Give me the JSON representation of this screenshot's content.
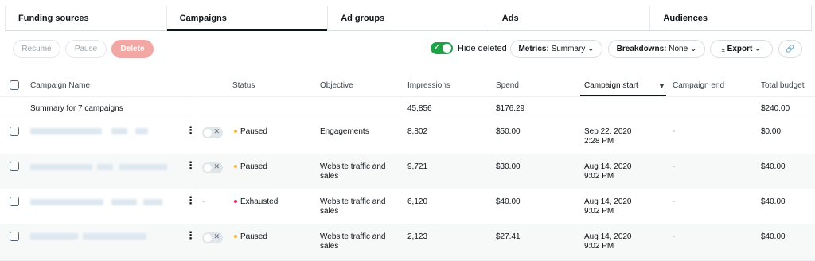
{
  "tabs": [
    "Funding sources",
    "Campaigns",
    "Ad groups",
    "Ads",
    "Audiences"
  ],
  "toolbar": {
    "resume": "Resume",
    "pause": "Pause",
    "delete": "Delete",
    "hide_deleted": "Hide deleted",
    "metrics_label": "Metrics:",
    "metrics_value": "Summary",
    "breakdowns_label": "Breakdowns:",
    "breakdowns_value": "None",
    "export": "Export"
  },
  "columns": {
    "name": "Campaign Name",
    "status": "Status",
    "objective": "Objective",
    "impressions": "Impressions",
    "spend": "Spend",
    "start": "Campaign start",
    "end": "Campaign end",
    "budget": "Total budget"
  },
  "summary": {
    "label": "Summary for 7 campaigns",
    "impressions": "45,856",
    "spend": "$176.29",
    "budget": "$240.00"
  },
  "rows": [
    {
      "status": "Paused",
      "status_color": "#f5b73b",
      "objective": "Engagements",
      "objective2": "",
      "impressions": "8,802",
      "spend": "$50.00",
      "start": "Sep 22, 2020",
      "start_time": "2:28 PM",
      "end": "-",
      "budget": "$0.00",
      "toggle": "-"
    },
    {
      "status": "Paused",
      "status_color": "#f5b73b",
      "objective": "Website traffic and",
      "objective2": "sales",
      "impressions": "9,721",
      "spend": "$30.00",
      "start": "Aug 14, 2020",
      "start_time": "9:02 PM",
      "end": "-",
      "budget": "$40.00",
      "toggle": "-"
    },
    {
      "status": "Exhausted",
      "status_color": "#e0245e",
      "objective": "Website traffic and",
      "objective2": "sales",
      "impressions": "6,120",
      "spend": "$40.00",
      "start": "Aug 14, 2020",
      "start_time": "9:02 PM",
      "end": "-",
      "budget": "$40.00",
      "toggle": "-"
    },
    {
      "status": "Paused",
      "status_color": "#f5b73b",
      "objective": "Website traffic and",
      "objective2": "sales",
      "impressions": "2,123",
      "spend": "$27.41",
      "start": "Aug 14, 2020",
      "start_time": "9:02 PM",
      "end": "-",
      "budget": "$40.00",
      "toggle": "-"
    }
  ],
  "icons": {
    "checkmark": "✓",
    "chevron": "⌄",
    "sort": "▼",
    "export": "⤓",
    "link": "🔗",
    "x": "✕"
  }
}
